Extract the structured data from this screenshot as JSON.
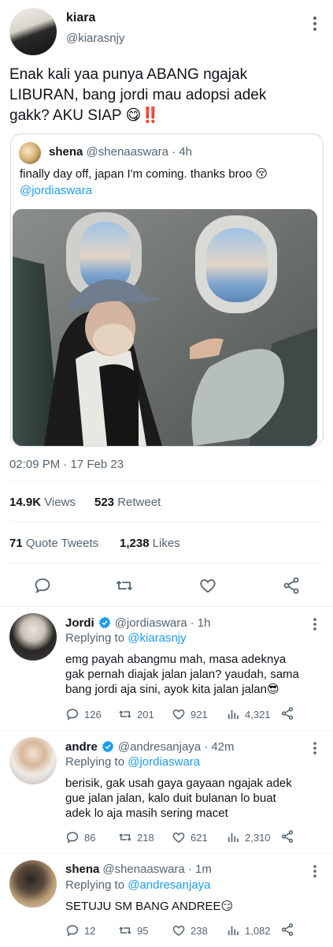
{
  "main_tweet": {
    "name": "kiara",
    "handle": "@kiarasnjy",
    "text_line1": "Enak kali yaa punya ABANG ngajak",
    "text_line2": "LIBURAN, bang jordi mau adopsi adek",
    "text_line3": "gakk? AKU SIAP 😋‼️",
    "timestamp": "02:09 PM · 17 Feb 23",
    "views_count": "14.9K",
    "views_label": "Views",
    "retweets_count": "523",
    "retweets_label": "Retweet",
    "quotes_count": "71",
    "quotes_label": "Quote Tweets",
    "likes_count": "1,238",
    "likes_label": "Likes"
  },
  "quoted_tweet": {
    "name": "shena",
    "handle": "@shenaaswara",
    "time": "· 4h",
    "text": "finally day off, japan I'm coming. thanks broo 😚",
    "mention": "@jordiaswara"
  },
  "replies": [
    {
      "name": "Jordi",
      "handle": "@jordiaswara",
      "time": "· 1h",
      "replying_prefix": "Replying to",
      "replying_to": "@kiarasnjy",
      "lines": [
        "emg payah abangmu mah, masa adeknya",
        "gak pernah diajak jalan jalan? yaudah, sama",
        "bang jordi aja sini, ayok kita jalan jalan😎"
      ],
      "replies": "126",
      "retweets": "201",
      "likes": "921",
      "views": "4,321",
      "verified": true
    },
    {
      "name": "andre",
      "handle": "@andresanjaya",
      "time": "· 42m",
      "replying_prefix": "Replying to",
      "replying_to": "@jordiaswara",
      "lines": [
        "berisik, gak usah gaya gayaan ngajak adek",
        "gue jalan jalan, kalo duit bulanan lo buat",
        "adek lo aja masih sering macet"
      ],
      "replies": "86",
      "retweets": "218",
      "likes": "621",
      "views": "2,310",
      "verified": true
    },
    {
      "name": "shena",
      "handle": "@shenaaswara",
      "time": "· 1m",
      "replying_prefix": "Replying to",
      "replying_to": "@andresanjaya",
      "lines": [
        "SETUJU SM BANG ANDREE😏"
      ],
      "replies": "12",
      "retweets": "95",
      "likes": "238",
      "views": "1,082",
      "verified": false
    }
  ],
  "colors": {
    "link": "#1d9bf0",
    "secondary_text": "#536471",
    "primary_text": "#0f1419",
    "divider": "#eff3f4"
  },
  "icons": [
    "more-icon",
    "reply-icon",
    "retweet-icon",
    "like-icon",
    "share-icon",
    "views-icon",
    "verified-badge-icon"
  ]
}
